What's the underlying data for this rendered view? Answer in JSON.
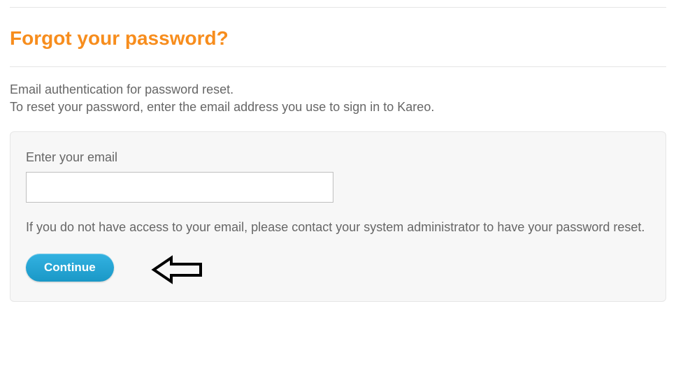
{
  "page": {
    "title": "Forgot your password?",
    "intro_line1": "Email authentication for password reset.",
    "intro_line2": "To reset your password, enter the email address you use to sign in to Kareo."
  },
  "form": {
    "email_label": "Enter your email",
    "email_value": "",
    "help_text": "If you do not have access to your email, please contact your system administrator to have your password reset.",
    "continue_label": "Continue"
  },
  "colors": {
    "heading": "#f78d1d",
    "button_top": "#33b2e1",
    "button_bottom": "#1a98c7",
    "text": "#666666",
    "panel_bg": "#f7f7f7"
  }
}
